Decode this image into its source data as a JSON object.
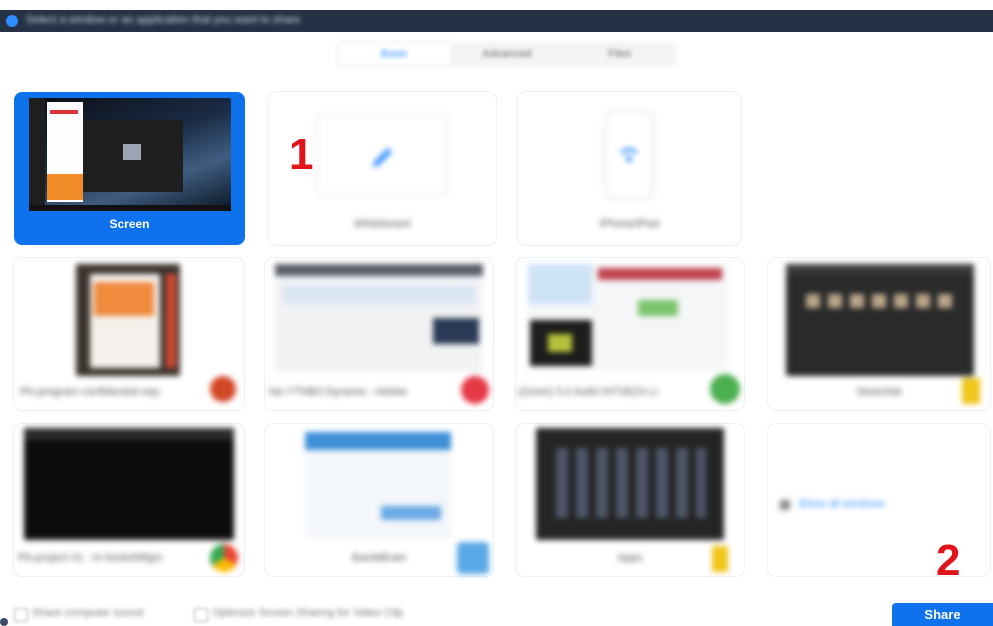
{
  "window": {
    "title": "Select a window or an application that you want to share"
  },
  "tabs": [
    {
      "label": "Basic",
      "active": true
    },
    {
      "label": "Advanced",
      "active": false
    },
    {
      "label": "Files",
      "active": false
    }
  ],
  "tiles": [
    {
      "id": "screen",
      "label": "Screen",
      "selected": true
    },
    {
      "id": "whiteboard",
      "label": "Whiteboard"
    },
    {
      "id": "iphone",
      "label": "iPhone/iPad"
    },
    {
      "id": "win1",
      "label": "Pb-program-confidential-nep",
      "icon": "powerpoint-icon"
    },
    {
      "id": "win2",
      "label": "Ne-YTNB3 Dynamo - Adobe",
      "icon": "acrobat-icon"
    },
    {
      "id": "win3",
      "label": "(Zoom) 5.0 build IHTSEZ4 Li",
      "icon": "green-app-icon"
    },
    {
      "id": "win4",
      "label": "Sketchbk",
      "icon": "folder-icon"
    },
    {
      "id": "win5",
      "label": "Pb-project 01 - in-Nodo/Mfgm",
      "icon": "chrome-icon"
    },
    {
      "id": "win6",
      "label": "BambBrain",
      "icon": "blue-app-icon"
    },
    {
      "id": "win7",
      "label": "Apps",
      "icon": "folder-icon"
    },
    {
      "id": "more",
      "label": "Show all windows"
    }
  ],
  "annotations": {
    "step1": "1",
    "step2": "2"
  },
  "bottom": {
    "share_sound": "Share computer sound",
    "optimize": "Optimize Screen Sharing for Video Clip",
    "share_button": "Share"
  },
  "colors": {
    "accent": "#0e72ed",
    "titlebar": "#253246",
    "annotation": "#e1141b"
  }
}
